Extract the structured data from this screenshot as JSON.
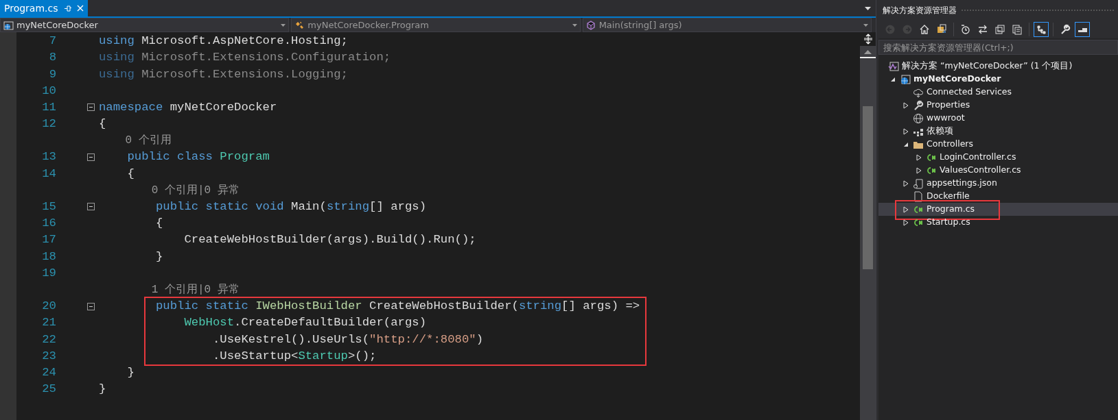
{
  "editor": {
    "tabs": [
      {
        "label": "Program.cs",
        "selected": true
      }
    ],
    "nav": [
      {
        "kind": "project",
        "text": "myNetCoreDocker"
      },
      {
        "kind": "class",
        "text": "myNetCoreDocker.Program"
      },
      {
        "kind": "method",
        "text": "Main(string[] args)"
      }
    ],
    "lines": [
      {
        "kind": "code",
        "number": "7",
        "fold": false,
        "boxed": false,
        "tokens": [
          {
            "kind": "kw",
            "text": "using"
          },
          {
            "kind": "plain",
            "text": " Microsoft.AspNetCore.Hosting;"
          }
        ]
      },
      {
        "kind": "code",
        "number": "8",
        "fold": false,
        "boxed": false,
        "tokens": [
          {
            "kind": "kw-dim",
            "text": "using"
          },
          {
            "kind": "dim",
            "text": " Microsoft.Extensions.Configuration;"
          }
        ]
      },
      {
        "kind": "code",
        "number": "9",
        "fold": false,
        "boxed": false,
        "tokens": [
          {
            "kind": "kw-dim",
            "text": "using"
          },
          {
            "kind": "dim",
            "text": " Microsoft.Extensions.Logging;"
          }
        ]
      },
      {
        "kind": "code",
        "number": "10",
        "fold": false,
        "boxed": false
      },
      {
        "kind": "code",
        "number": "11",
        "fold": true,
        "boxed": false,
        "tokens": [
          {
            "kind": "kw",
            "text": "namespace"
          },
          {
            "kind": "plain",
            "text": " myNetCoreDocker"
          }
        ]
      },
      {
        "kind": "code",
        "number": "12",
        "fold": false,
        "boxed": false,
        "tokens": [
          {
            "kind": "plain",
            "text": "{"
          }
        ]
      },
      {
        "kind": "lens",
        "text": "    0 个引用"
      },
      {
        "kind": "code",
        "number": "13",
        "fold": true,
        "boxed": false,
        "tokens": [
          {
            "kind": "kw",
            "text": "    public class"
          },
          {
            "kind": "type",
            "text": " Program"
          }
        ]
      },
      {
        "kind": "code",
        "number": "14",
        "fold": false,
        "boxed": false,
        "tokens": [
          {
            "kind": "plain",
            "text": "    {"
          }
        ]
      },
      {
        "kind": "lens",
        "text": "        0 个引用|0 异常"
      },
      {
        "kind": "code",
        "number": "15",
        "fold": true,
        "boxed": false,
        "tokens": [
          {
            "kind": "kw",
            "text": "        public static void"
          },
          {
            "kind": "plain",
            "text": " Main("
          },
          {
            "kind": "kw",
            "text": "string"
          },
          {
            "kind": "plain",
            "text": "[] args)"
          }
        ]
      },
      {
        "kind": "code",
        "number": "16",
        "fold": false,
        "boxed": false,
        "tokens": [
          {
            "kind": "plain",
            "text": "        {"
          }
        ]
      },
      {
        "kind": "code",
        "number": "17",
        "fold": false,
        "boxed": false,
        "tokens": [
          {
            "kind": "plain",
            "text": "            CreateWebHostBuilder(args).Build().Run();"
          }
        ]
      },
      {
        "kind": "code",
        "number": "18",
        "fold": false,
        "boxed": false,
        "tokens": [
          {
            "kind": "plain",
            "text": "        }"
          }
        ]
      },
      {
        "kind": "code",
        "number": "19",
        "fold": false,
        "boxed": false
      },
      {
        "kind": "lens",
        "text": "        1 个引用|0 异常"
      },
      {
        "kind": "code",
        "number": "20",
        "fold": true,
        "boxed": true,
        "tokens": [
          {
            "kind": "kw",
            "text": "        public static"
          },
          {
            "kind": "iface",
            "text": " IWebHostBuilder"
          },
          {
            "kind": "plain",
            "text": " CreateWebHostBuilder("
          },
          {
            "kind": "kw",
            "text": "string"
          },
          {
            "kind": "plain",
            "text": "[] args) =>"
          }
        ]
      },
      {
        "kind": "code",
        "number": "21",
        "fold": false,
        "boxed": true,
        "tokens": [
          {
            "kind": "type",
            "text": "            WebHost"
          },
          {
            "kind": "plain",
            "text": ".CreateDefaultBuilder(args)"
          }
        ]
      },
      {
        "kind": "code",
        "number": "22",
        "fold": false,
        "boxed": true,
        "tokens": [
          {
            "kind": "plain",
            "text": "                .UseKestrel().UseUrls("
          },
          {
            "kind": "str",
            "text": "\"http://*:8080\""
          },
          {
            "kind": "plain",
            "text": ")"
          }
        ]
      },
      {
        "kind": "code",
        "number": "23",
        "fold": false,
        "boxed": true,
        "tokens": [
          {
            "kind": "plain",
            "text": "                .UseStartup<"
          },
          {
            "kind": "type",
            "text": "Startup"
          },
          {
            "kind": "plain",
            "text": ">();"
          }
        ]
      },
      {
        "kind": "code",
        "number": "24",
        "fold": false,
        "boxed": false,
        "tokens": [
          {
            "kind": "plain",
            "text": "    }"
          }
        ]
      },
      {
        "kind": "code",
        "number": "25",
        "fold": false,
        "boxed": false,
        "tokens": [
          {
            "kind": "plain",
            "text": "}"
          }
        ]
      }
    ]
  },
  "explorer": {
    "title": "解决方案资源管理器",
    "toolbar": [
      {
        "kind": "back",
        "disabled": true,
        "selected": false
      },
      {
        "kind": "forward",
        "disabled": true,
        "selected": false
      },
      {
        "kind": "home",
        "disabled": false,
        "selected": false
      },
      {
        "kind": "sync",
        "disabled": false,
        "selected": false
      },
      {
        "kind": "sep"
      },
      {
        "kind": "history",
        "disabled": false,
        "selected": false
      },
      {
        "kind": "switch",
        "disabled": false,
        "selected": false
      },
      {
        "kind": "collapse",
        "disabled": false,
        "selected": false
      },
      {
        "kind": "copy",
        "disabled": false,
        "selected": false
      },
      {
        "kind": "sep"
      },
      {
        "kind": "tree",
        "disabled": false,
        "selected": true
      },
      {
        "kind": "sep"
      },
      {
        "kind": "wrench",
        "disabled": false,
        "selected": false
      },
      {
        "kind": "preview",
        "disabled": false,
        "selected": true
      }
    ],
    "search": {
      "placeholder": "搜索解决方案资源管理器(Ctrl+;)"
    },
    "tree": [
      {
        "label": "解决方案 “myNetCoreDocker” (1 个项目)",
        "kind": "solution",
        "selected": false,
        "boxed": false,
        "children": [
          {
            "label": "myNetCoreDocker",
            "kind": "project",
            "expanded": true,
            "selected": false,
            "boxed": false,
            "children": [
              {
                "label": "Connected Services",
                "kind": "connected",
                "selected": false,
                "boxed": false
              },
              {
                "label": "Properties",
                "kind": "wrench",
                "expanded": false,
                "selected": false,
                "boxed": false
              },
              {
                "label": "wwwroot",
                "kind": "globe",
                "selected": false,
                "boxed": false
              },
              {
                "label": "依赖项",
                "kind": "deps",
                "expanded": false,
                "selected": false,
                "boxed": false
              },
              {
                "label": "Controllers",
                "kind": "folder",
                "expanded": true,
                "selected": false,
                "boxed": false,
                "children": [
                  {
                    "label": "LoginController.cs",
                    "kind": "csharp",
                    "expanded": false,
                    "selected": false,
                    "boxed": false
                  },
                  {
                    "label": "ValuesController.cs",
                    "kind": "csharp",
                    "expanded": false,
                    "selected": false,
                    "boxed": false
                  }
                ]
              },
              {
                "label": "appsettings.json",
                "kind": "json",
                "expanded": false,
                "selected": false,
                "boxed": false
              },
              {
                "label": "Dockerfile",
                "kind": "file",
                "selected": false,
                "boxed": false
              },
              {
                "label": "Program.cs",
                "kind": "csharp",
                "expanded": false,
                "selected": true,
                "boxed": true
              },
              {
                "label": "Startup.cs",
                "kind": "csharp",
                "expanded": false,
                "selected": false,
                "boxed": false
              }
            ]
          }
        ]
      }
    ]
  }
}
